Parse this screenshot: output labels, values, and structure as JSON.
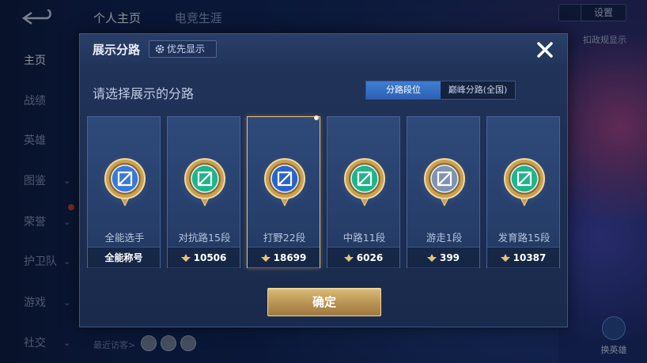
{
  "background": {
    "top_tabs": [
      "个人主页",
      "电竞生涯"
    ],
    "nav_items": [
      {
        "label": "主页",
        "active": true,
        "chevron": false
      },
      {
        "label": "战绩",
        "active": false,
        "chevron": false
      },
      {
        "label": "英雄",
        "active": false,
        "chevron": false
      },
      {
        "label": "图鉴",
        "active": false,
        "chevron": true
      },
      {
        "label": "荣誉",
        "active": false,
        "chevron": true
      },
      {
        "label": "护卫队",
        "active": false,
        "chevron": true
      },
      {
        "label": "游戏",
        "active": false,
        "chevron": true
      },
      {
        "label": "社交",
        "active": false,
        "chevron": true
      }
    ],
    "back_icon": "back-arrow-icon",
    "recent_visitors_label": "最近访客>",
    "right_top_button": "设置",
    "right_label": "扣政规显示",
    "switch_hero_label": "换英雄"
  },
  "modal": {
    "title": "展示分路",
    "priority_button": "优先显示",
    "priority_icon": "gear-icon",
    "close_icon": "close-icon",
    "subtitle": "请选择展示的分路",
    "tabs": [
      {
        "label": "分路段位",
        "active": true
      },
      {
        "label": "巅峰分路(全国)",
        "active": false
      }
    ],
    "cards": [
      {
        "label": "全能选手",
        "footer": "全能称号",
        "show_points_icon": false,
        "selected": false,
        "icon": "all-rounder-badge-icon",
        "gem_color": "#3b78d8"
      },
      {
        "label": "对抗路15段",
        "footer": "10506",
        "show_points_icon": true,
        "selected": false,
        "icon": "clash-lane-badge-icon",
        "gem_color": "#1fb48a"
      },
      {
        "label": "打野22段",
        "footer": "18699",
        "show_points_icon": true,
        "selected": true,
        "icon": "jungle-badge-icon",
        "gem_color": "#2a63c9"
      },
      {
        "label": "中路11段",
        "footer": "6026",
        "show_points_icon": true,
        "selected": false,
        "icon": "mid-lane-badge-icon",
        "gem_color": "#1fb48a"
      },
      {
        "label": "游走1段",
        "footer": "399",
        "show_points_icon": true,
        "selected": false,
        "icon": "roam-badge-icon",
        "gem_color": "#7f93b3"
      },
      {
        "label": "发育路15段",
        "footer": "10387",
        "show_points_icon": true,
        "selected": false,
        "icon": "farm-lane-badge-icon",
        "gem_color": "#1fb48a"
      }
    ],
    "confirm_button": "确定"
  },
  "colors": {
    "accent_blue": "#2c62b4",
    "gold": "#d9bb79",
    "selected_border": "#e6c27a"
  }
}
